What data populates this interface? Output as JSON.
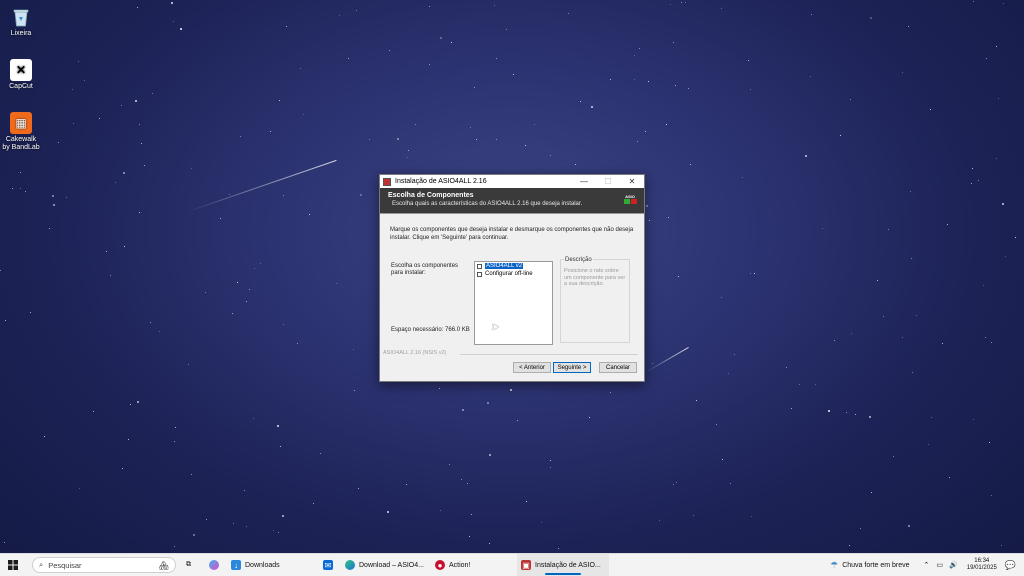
{
  "desktop": {
    "icons": [
      {
        "label": "Lixeira",
        "icon": "recycle-bin-icon"
      },
      {
        "label": "CapCut",
        "icon": "capcut-icon"
      },
      {
        "label": "Cakewalk by BandLab",
        "icon": "cakewalk-icon"
      }
    ]
  },
  "window": {
    "title": "Instalação de ASIO4ALL 2.16",
    "header_title": "Escolha de Componentes",
    "header_subtitle": "Escolha quais as características do ASIO4ALL 2.16 que deseja instalar.",
    "logo_text": "ASIO",
    "instructions": "Marque os componentes que deseja instalar e desmarque os componentes que não deseja instalar. Clique em 'Seguinte' para continuar.",
    "components_label": "Escolha os componentes para instalar:",
    "space_label": "Espaço necessário: 766.0 KB",
    "components": [
      {
        "label": "ASIO4ALL v2",
        "checked": true,
        "selected": true
      },
      {
        "label": "Configurar off-line",
        "checked": false,
        "selected": false
      }
    ],
    "description_legend": "Descrição",
    "description_text": "Posicione o rato sobre um componente para ver a sua descrição.",
    "branding": "ASIO4ALL 2.16 (NSIS v2)",
    "buttons": {
      "back": "< Anterior",
      "next": "Seguinte >",
      "cancel": "Cancelar"
    }
  },
  "taskbar": {
    "search_placeholder": "Pesquisar",
    "items": [
      {
        "label": "Downloads",
        "icon": "downloads-icon"
      },
      {
        "label": "Download – ASIO4...",
        "icon": "edge-icon"
      },
      {
        "label": "Action!",
        "icon": "action-icon"
      },
      {
        "label": "Instalação de ASIO...",
        "icon": "installer-icon"
      }
    ],
    "weather": "Chuva forte em breve",
    "time": "16:34",
    "date": "19/01/2025"
  }
}
